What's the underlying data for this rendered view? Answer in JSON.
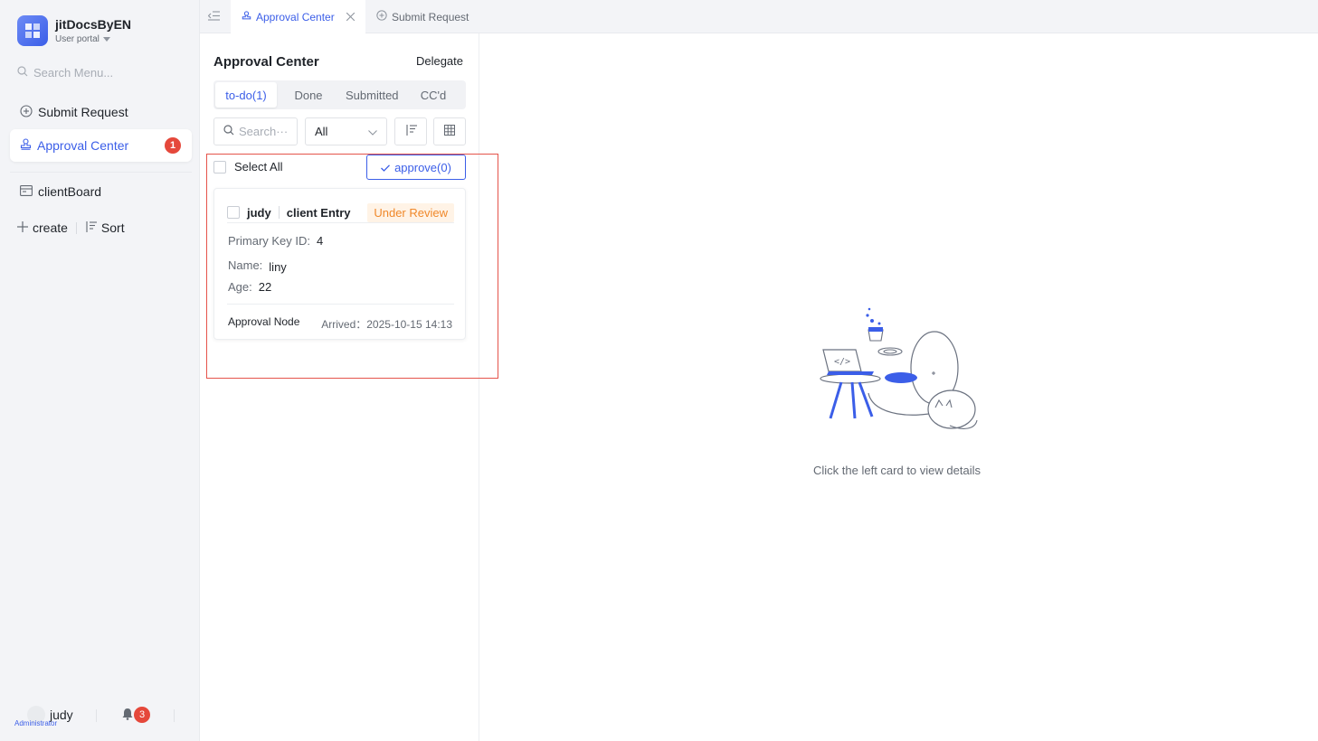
{
  "app": {
    "name": "jitDocsByEN",
    "portal": "User portal"
  },
  "sidebar": {
    "search_placeholder": "Search Menu...",
    "items": [
      {
        "label": "Submit Request",
        "icon": "plus-circle-icon"
      },
      {
        "label": "Approval Center",
        "icon": "stamp-icon",
        "badge": "1"
      },
      {
        "label": "clientBoard",
        "icon": "board-icon"
      }
    ],
    "create_label": "create",
    "sort_label": "Sort"
  },
  "footer": {
    "user_name": "judy",
    "role": "Administrator",
    "notification_count": "3"
  },
  "tabs": [
    {
      "label": "Approval Center",
      "active": true
    },
    {
      "label": "Submit Request",
      "active": false
    }
  ],
  "approval": {
    "title": "Approval Center",
    "delegate_label": "Delegate",
    "segments": [
      "to-do(1)",
      "Done",
      "Submitted",
      "CC'd"
    ],
    "search_placeholder": "Search···",
    "filter_value": "All",
    "select_all_label": "Select All",
    "approve_label": "approve(0)"
  },
  "card": {
    "submitter": "judy",
    "form_name": "client Entry",
    "status": "Under Review",
    "fields": [
      {
        "label": "Primary Key ID:",
        "value": "4"
      },
      {
        "label": "Name:",
        "value": "liny"
      },
      {
        "label": "Age:",
        "value": "22"
      }
    ],
    "node_label": "Approval Node",
    "arrived_label": "Arrived：",
    "arrived_time": "2025-10-15 14:13"
  },
  "detail": {
    "empty_text": "Click the left card to view details"
  },
  "colors": {
    "accent": "#3b5ee8",
    "badge": "#e5483b",
    "warning": "#f0882a",
    "highlight_border": "#e5544b"
  }
}
